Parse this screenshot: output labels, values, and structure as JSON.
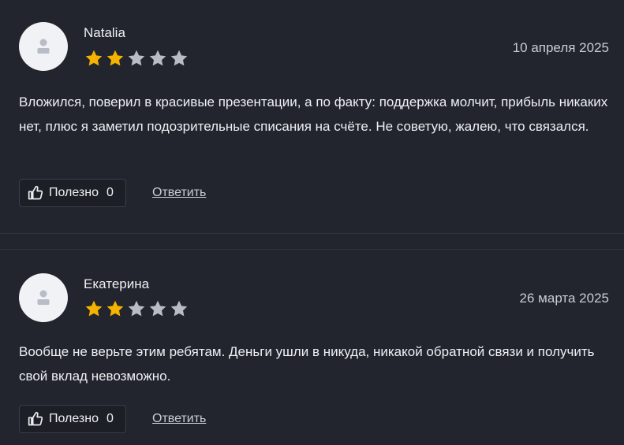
{
  "reviews": [
    {
      "author": "Natalia",
      "rating": 2,
      "max_rating": 5,
      "date": "10 апреля 2025",
      "text": "Вложился, поверил в красивые презентации, а по факту: поддержка молчит, прибыль никаких нет, плюс я заметил подозрительные списания на счёте. Не советую, жалею, что связался.",
      "helpful_label": "Полезно",
      "helpful_count": "0",
      "reply_label": "Ответить"
    },
    {
      "author": "Екатерина",
      "rating": 2,
      "max_rating": 5,
      "date": "26 марта 2025",
      "text": "Вообще не верьте этим ребятам. Деньги ушли в никуда, никакой обратной связи и получить свой вклад невозможно.",
      "helpful_label": "Полезно",
      "helpful_count": "0",
      "reply_label": "Ответить"
    }
  ],
  "colors": {
    "star_filled": "#f5b301",
    "star_empty": "#b8bcc6",
    "avatar_bg": "#f1f2f5",
    "avatar_icon": "#b7bcc7"
  },
  "icons": {
    "avatar": "user-icon",
    "helpful": "thumbs-up-icon",
    "star": "star-icon"
  }
}
